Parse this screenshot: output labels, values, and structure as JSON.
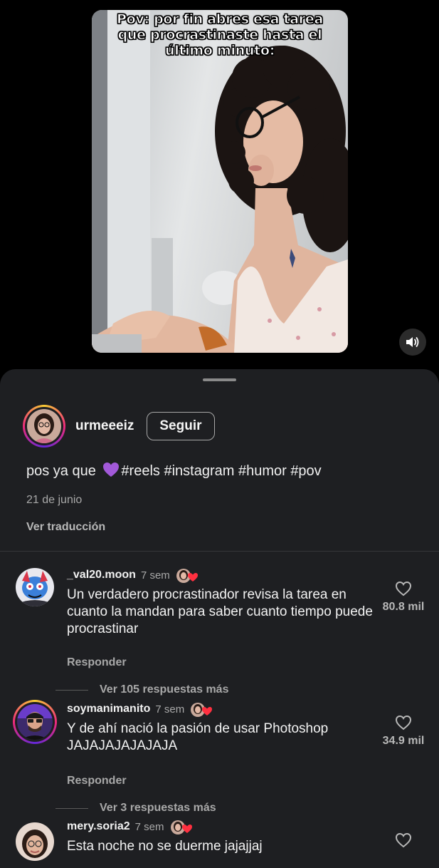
{
  "video": {
    "overlay_text": "Pov: por fin abres esa tarea que procrastinaste hasta el último minuto:",
    "volume_icon": "speaker-icon"
  },
  "post": {
    "username": "urmeeeiz",
    "follow_label": "Seguir",
    "caption_text": "pos ya que",
    "caption_emoji": "purple-heart",
    "hashtags": "#reels #instagram #humor #pov",
    "date": "21 de junio",
    "translate_label": "Ver traducción"
  },
  "comments": [
    {
      "username": "_val20.moon",
      "time": "7 sem",
      "text": "Un verdadero procrastinador revisa la tarea en cuanto la mandan para saber cuanto tiempo puede procrastinar",
      "reply_label": "Responder",
      "likes": "80.8 mil",
      "view_replies": "Ver 105 respuestas más"
    },
    {
      "username": "soymanimanito",
      "time": "7 sem",
      "text": "Y de ahí nació la pasión de usar Photoshop JAJAJAJAJAJAJA",
      "reply_label": "Responder",
      "likes": "34.9 mil",
      "view_replies": "Ver 3 respuestas más"
    },
    {
      "username": "mery.soria2",
      "time": "7 sem",
      "text": "Esta noche no se duerme jajajjaj"
    }
  ],
  "colors": {
    "sheet_bg": "#1e1f22",
    "muted_text": "#a8a8a8",
    "heart_red": "#ff3040"
  }
}
